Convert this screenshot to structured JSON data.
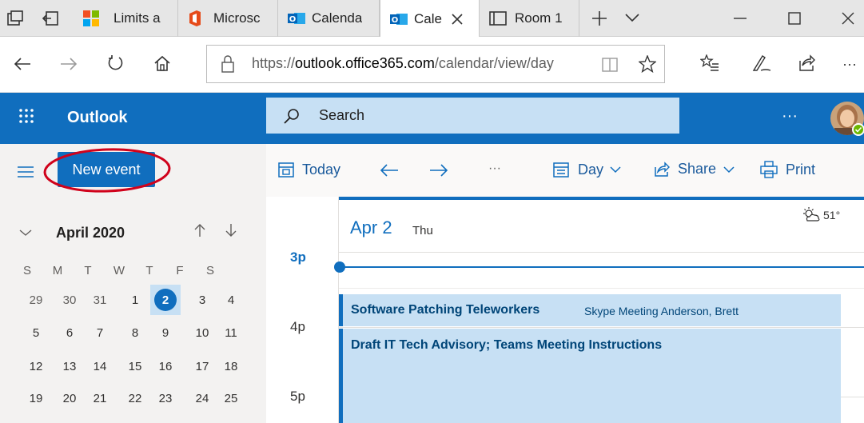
{
  "browser": {
    "tabs": [
      {
        "label": "Limits a",
        "icon": "windows-logo-icon"
      },
      {
        "label": "Microsc",
        "icon": "office-logo-icon"
      },
      {
        "label": "Calenda",
        "icon": "outlook-logo-icon"
      },
      {
        "label": "Cale",
        "icon": "outlook-logo-icon",
        "active": true
      },
      {
        "label": "Room 1",
        "icon": "window-icon"
      }
    ],
    "url_prefix": "https://",
    "url_domain": "outlook.office365.com",
    "url_path": "/calendar/view/day"
  },
  "outlook": {
    "app_name": "Outlook",
    "search_placeholder": "Search",
    "more_label": "···",
    "new_event_label": "New event",
    "toolbar": {
      "today": "Today",
      "day": "Day",
      "share": "Share",
      "print": "Print",
      "more": "···"
    },
    "mini_calendar": {
      "month_label": "April 2020",
      "weekday_headers": [
        "S",
        "M",
        "T",
        "W",
        "T",
        "F",
        "S"
      ],
      "weeks": [
        [
          "29",
          "30",
          "31",
          "1",
          "2",
          "3",
          "4"
        ],
        [
          "5",
          "6",
          "7",
          "8",
          "9",
          "10",
          "11"
        ],
        [
          "12",
          "13",
          "14",
          "15",
          "16",
          "17",
          "18"
        ],
        [
          "19",
          "20",
          "21",
          "22",
          "23",
          "24",
          "25"
        ]
      ],
      "selected_day": "2"
    },
    "day_view": {
      "date_label": "Apr 2",
      "weekday_label": "Thu",
      "weather": "51°",
      "hours": [
        "3p",
        "4p",
        "5p"
      ],
      "events": [
        {
          "title": "Software Patching Teleworkers",
          "details": "Skype Meeting Anderson, Brett"
        },
        {
          "title": "Draft IT Tech Advisory; Teams Meeting Instructions",
          "details": ""
        }
      ]
    }
  },
  "colors": {
    "brand_blue": "#106ebe",
    "event_fill": "#c7e0f4",
    "highlight_circle": "#d0021b"
  }
}
